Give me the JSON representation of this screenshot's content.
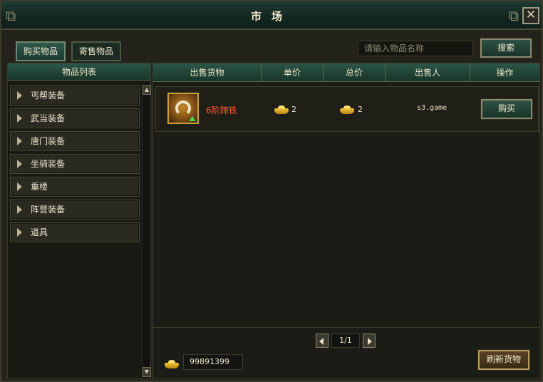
{
  "window": {
    "title": "市场",
    "close_glyph": "✕",
    "corner_left": "❁",
    "corner_right": "❁"
  },
  "tabs": [
    {
      "label": "购买物品",
      "active": true
    },
    {
      "label": "寄售物品",
      "active": false
    }
  ],
  "search": {
    "placeholder": "请输入物品名称",
    "value": "",
    "button_label": "搜索"
  },
  "left_panel": {
    "header": "物品列表",
    "categories": [
      "丐帮装备",
      "武当装备",
      "唐门装备",
      "坐骑装备",
      "重楼",
      "阵营装备",
      "道具"
    ]
  },
  "table": {
    "columns": [
      "出售货物",
      "单价",
      "总价",
      "出售人",
      "操作"
    ],
    "rows": [
      {
        "item_name": "6阶蹄铁",
        "unit_price": "2",
        "total_price": "2",
        "seller": "s3.game",
        "action_label": "购买",
        "item_icon": "horseshoe-icon"
      }
    ]
  },
  "pagination": {
    "text": "1/1"
  },
  "money": {
    "amount": "99891399",
    "icon": "gold-ingot-icon"
  },
  "refresh_label": "刷新货物",
  "colors": {
    "accent_green": "#2c5648",
    "item_name_red": "#ff5a2e",
    "gold": "#f5c739"
  }
}
